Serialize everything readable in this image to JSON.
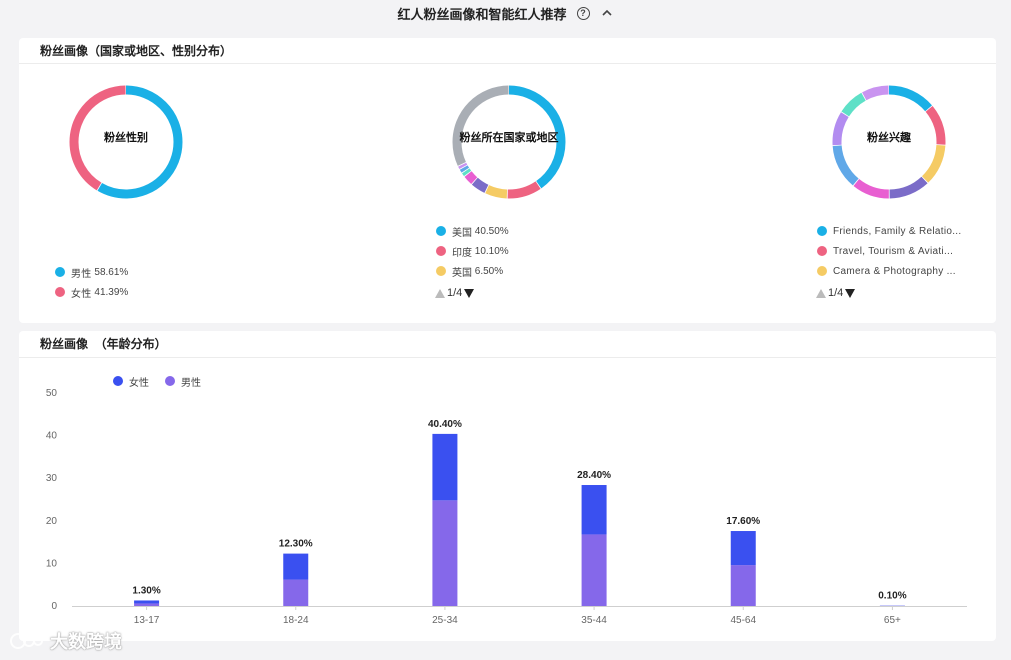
{
  "header": {
    "title": "红人粉丝画像和智能红人推荐",
    "help_glyph": "?"
  },
  "section1": {
    "title": "粉丝画像（国家或地区、性别分布）",
    "gender": {
      "label": "粉丝性别",
      "slices": [
        {
          "name": "男性",
          "value": "58.61%",
          "pct": 58.61,
          "color": "#1ab0e6"
        },
        {
          "name": "女性",
          "value": "41.39%",
          "pct": 41.39,
          "color": "#ee6381"
        }
      ]
    },
    "country": {
      "label": "粉丝所在国家或地区",
      "legend": [
        {
          "name": "美国",
          "value": "40.50%",
          "color": "#1ab0e6"
        },
        {
          "name": "印度",
          "value": "10.10%",
          "color": "#ee6381"
        },
        {
          "name": "英国",
          "value": "6.50%",
          "color": "#f5cb64"
        }
      ],
      "ring": [
        {
          "pct": 40.5,
          "color": "#1ab0e6"
        },
        {
          "pct": 10.1,
          "color": "#ee6381"
        },
        {
          "pct": 6.5,
          "color": "#f5cb64"
        },
        {
          "pct": 4.5,
          "color": "#7b6cc8"
        },
        {
          "pct": 3.0,
          "color": "#e85fd1"
        },
        {
          "pct": 1.2,
          "color": "#5ee0c7"
        },
        {
          "pct": 1.2,
          "color": "#60a8e8"
        },
        {
          "pct": 1.0,
          "color": "#c994f0"
        },
        {
          "pct": 32.0,
          "color": "#a9aeb5"
        }
      ],
      "pager": "1/4"
    },
    "interest": {
      "label": "粉丝兴趣",
      "legend": [
        {
          "name": "Friends, Family & Relatio...",
          "color": "#1ab0e6"
        },
        {
          "name": "Travel, Tourism & Aviati...",
          "color": "#ee6381"
        },
        {
          "name": "Camera & Photography ...",
          "color": "#f5cb64"
        }
      ],
      "ring": [
        {
          "pct": 14,
          "color": "#1ab0e6"
        },
        {
          "pct": 12,
          "color": "#ee6381"
        },
        {
          "pct": 12,
          "color": "#f5cb64"
        },
        {
          "pct": 12,
          "color": "#7b6cc8"
        },
        {
          "pct": 11,
          "color": "#e85fd1"
        },
        {
          "pct": 13,
          "color": "#60a8e8"
        },
        {
          "pct": 10,
          "color": "#b28cf0"
        },
        {
          "pct": 8,
          "color": "#5ee0c7"
        },
        {
          "pct": 8,
          "color": "#c994f0"
        }
      ],
      "pager": "1/4"
    }
  },
  "section2": {
    "title": "粉丝画像  （年龄分布）",
    "legend": [
      {
        "name": "女性",
        "color": "#3a50f0"
      },
      {
        "name": "男性",
        "color": "#8568ea"
      }
    ]
  },
  "chart_data": {
    "type": "bar",
    "stacked": true,
    "categories": [
      "13-17",
      "18-24",
      "25-34",
      "35-44",
      "45-64",
      "65+"
    ],
    "series": [
      {
        "name": "男性",
        "color": "#8568ea",
        "values": [
          0.6,
          6.2,
          24.8,
          16.8,
          9.6,
          0.05
        ]
      },
      {
        "name": "女性",
        "color": "#3a50f0",
        "values": [
          0.7,
          6.1,
          15.6,
          11.6,
          8.0,
          0.05
        ]
      }
    ],
    "totals": [
      "1.30%",
      "12.30%",
      "40.40%",
      "28.40%",
      "17.60%",
      "0.10%"
    ],
    "total_values": [
      1.3,
      12.3,
      40.4,
      28.4,
      17.6,
      0.1
    ],
    "yticks": [
      0,
      10,
      20,
      30,
      40,
      50
    ],
    "ylim": [
      0,
      50
    ],
    "grid": false,
    "legend_position": "top-left"
  },
  "watermark": {
    "text": "大数跨境"
  }
}
